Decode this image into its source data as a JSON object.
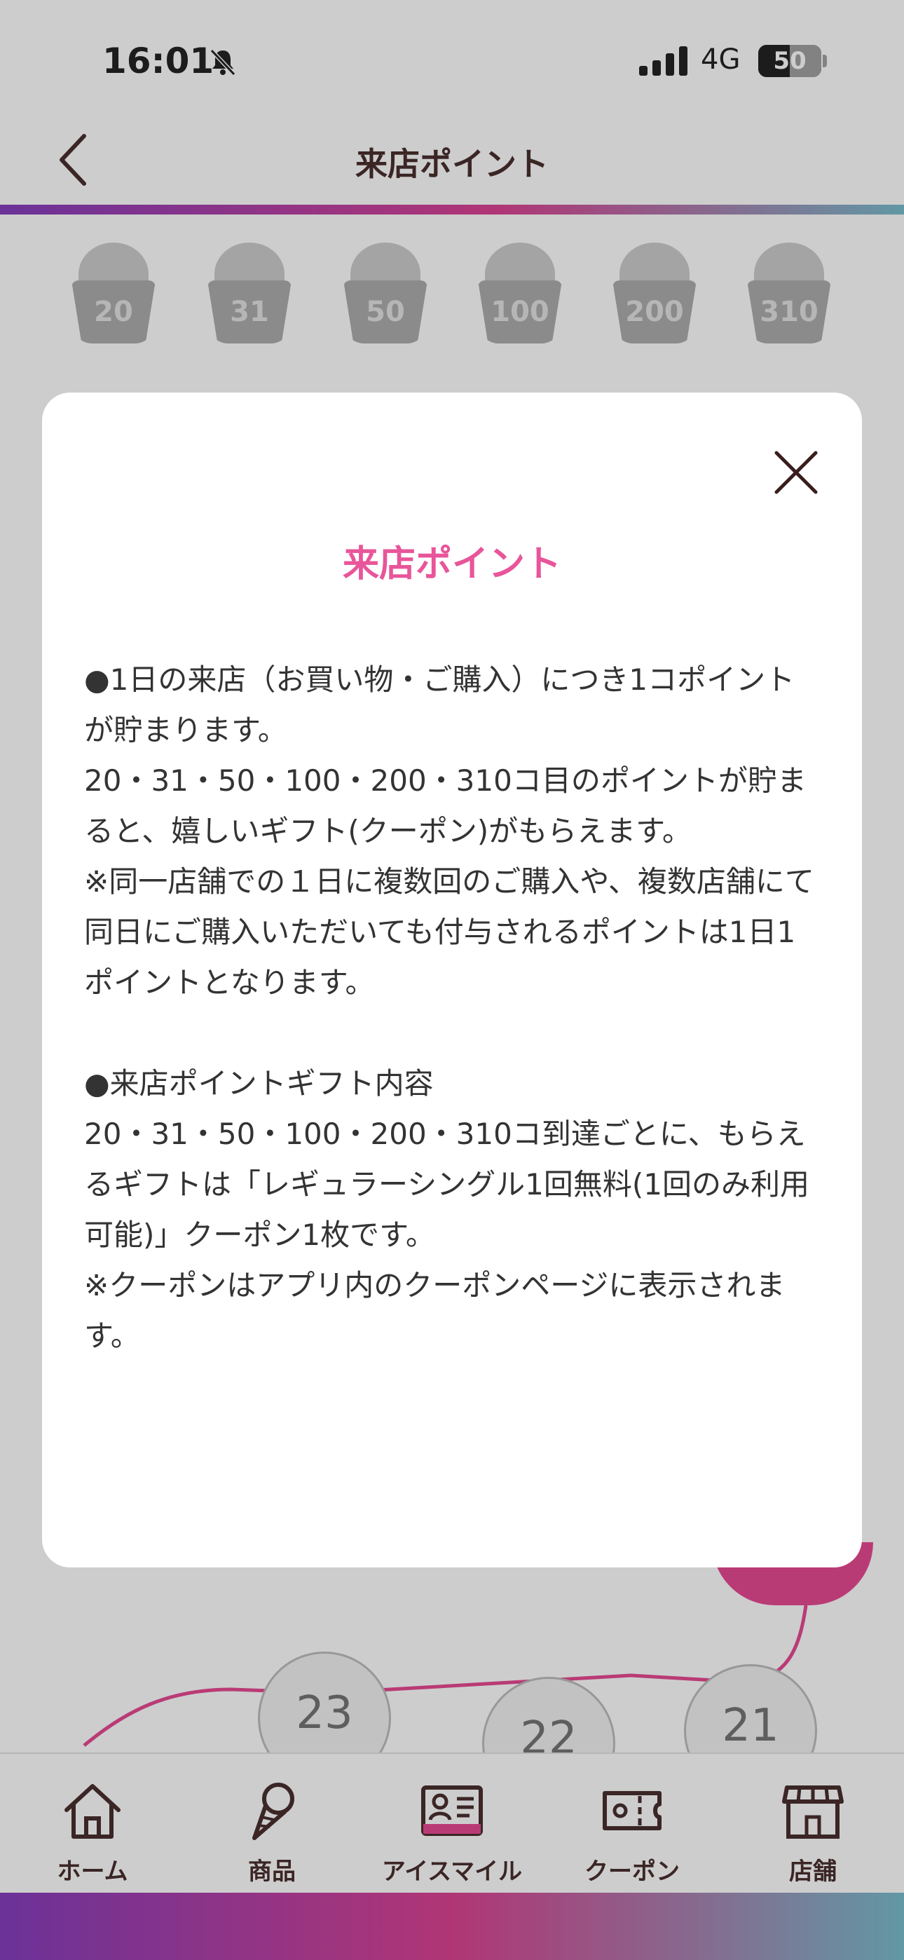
{
  "status_bar": {
    "time": "16:01",
    "network": "4G",
    "battery_level": "50",
    "battery_fraction": 0.5
  },
  "header": {
    "title": "来店ポイント"
  },
  "milestones": [
    "20",
    "31",
    "50",
    "100",
    "200",
    "310"
  ],
  "map_nodes": [
    "23",
    "22",
    "21"
  ],
  "modal": {
    "title": "来店ポイント",
    "paragraphs": [
      "●1日の来店（お買い物・ご購入）につき1コポイントが貯まります。",
      "20・31・50・100・200・310コ目のポイントが貯まると、嬉しいギフト(クーポン)がもらえます。",
      "※同一店舗での１日に複数回のご購入や、複数店舗にて同日にご購入いただいても付与されるポイントは1日1ポイントとなります。",
      "●来店ポイントギフト内容",
      "20・31・50・100・200・310コ到達ごとに、もらえるギフトは「レギュラーシングル1回無料(1回のみ利用可能)」クーポン1枚です。",
      "※クーポンはアプリ内のクーポンページに表示されます。"
    ]
  },
  "tab_bar": {
    "items": [
      {
        "label": "ホーム",
        "icon": "home-icon"
      },
      {
        "label": "商品",
        "icon": "ice-cream-cone-icon"
      },
      {
        "label": "アイスマイル",
        "icon": "member-card-icon"
      },
      {
        "label": "クーポン",
        "icon": "coupon-ticket-icon"
      },
      {
        "label": "店舗",
        "icon": "store-icon"
      }
    ]
  },
  "colors": {
    "accent_pink": "#e8559a",
    "dark_brown": "#3a1d1d",
    "gradient": [
      "#7b2fb8",
      "#d9338a",
      "#6fb7c8"
    ]
  }
}
